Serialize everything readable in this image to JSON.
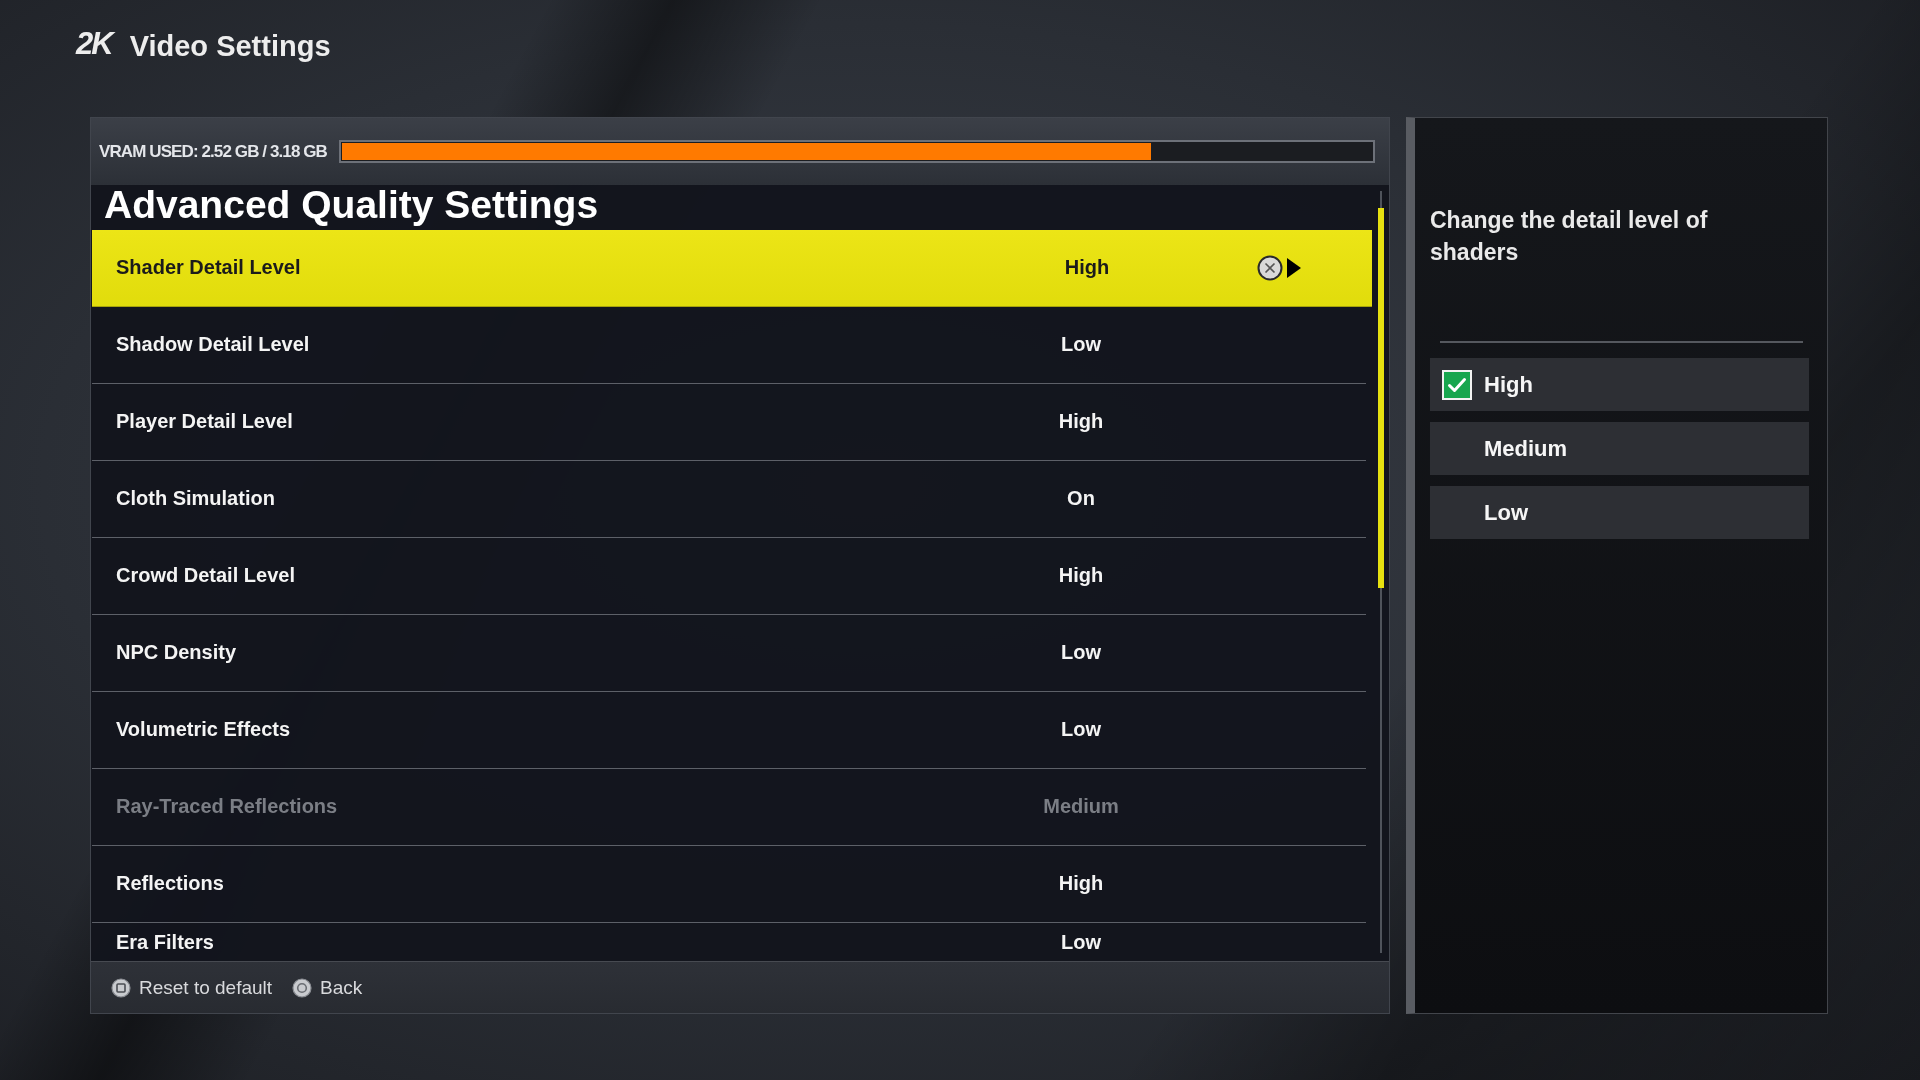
{
  "header": {
    "logo": "2K",
    "title": "Video Settings"
  },
  "vram": {
    "label": "VRAM USED: 2.52 GB / 3.18 GB",
    "level": 0.785
  },
  "settings": {
    "heading": "Advanced Quality Settings",
    "rows": [
      {
        "label": "Shader Detail Level",
        "value": "High",
        "selected": true,
        "disabled": false
      },
      {
        "label": "Shadow Detail Level",
        "value": "Low",
        "selected": false,
        "disabled": false
      },
      {
        "label": "Player Detail Level",
        "value": "High",
        "selected": false,
        "disabled": false
      },
      {
        "label": "Cloth Simulation",
        "value": "On",
        "selected": false,
        "disabled": false
      },
      {
        "label": "Crowd Detail Level",
        "value": "High",
        "selected": false,
        "disabled": false
      },
      {
        "label": "NPC Density",
        "value": "Low",
        "selected": false,
        "disabled": false
      },
      {
        "label": "Volumetric Effects",
        "value": "Low",
        "selected": false,
        "disabled": false
      },
      {
        "label": "Ray-Traced Reflections",
        "value": "Medium",
        "selected": false,
        "disabled": true
      },
      {
        "label": "Reflections",
        "value": "High",
        "selected": false,
        "disabled": false
      },
      {
        "label": "Era Filters",
        "value": "Low",
        "selected": false,
        "disabled": false
      }
    ]
  },
  "footer": {
    "actions": [
      {
        "label": "Reset to default",
        "kind": "square"
      },
      {
        "label": "Back",
        "kind": "circle"
      }
    ]
  },
  "detail_panel": {
    "description": "Change the detail level of shaders",
    "options": [
      {
        "label": "High",
        "selected": true
      },
      {
        "label": "Medium",
        "selected": false
      },
      {
        "label": "Low",
        "selected": false
      }
    ]
  }
}
